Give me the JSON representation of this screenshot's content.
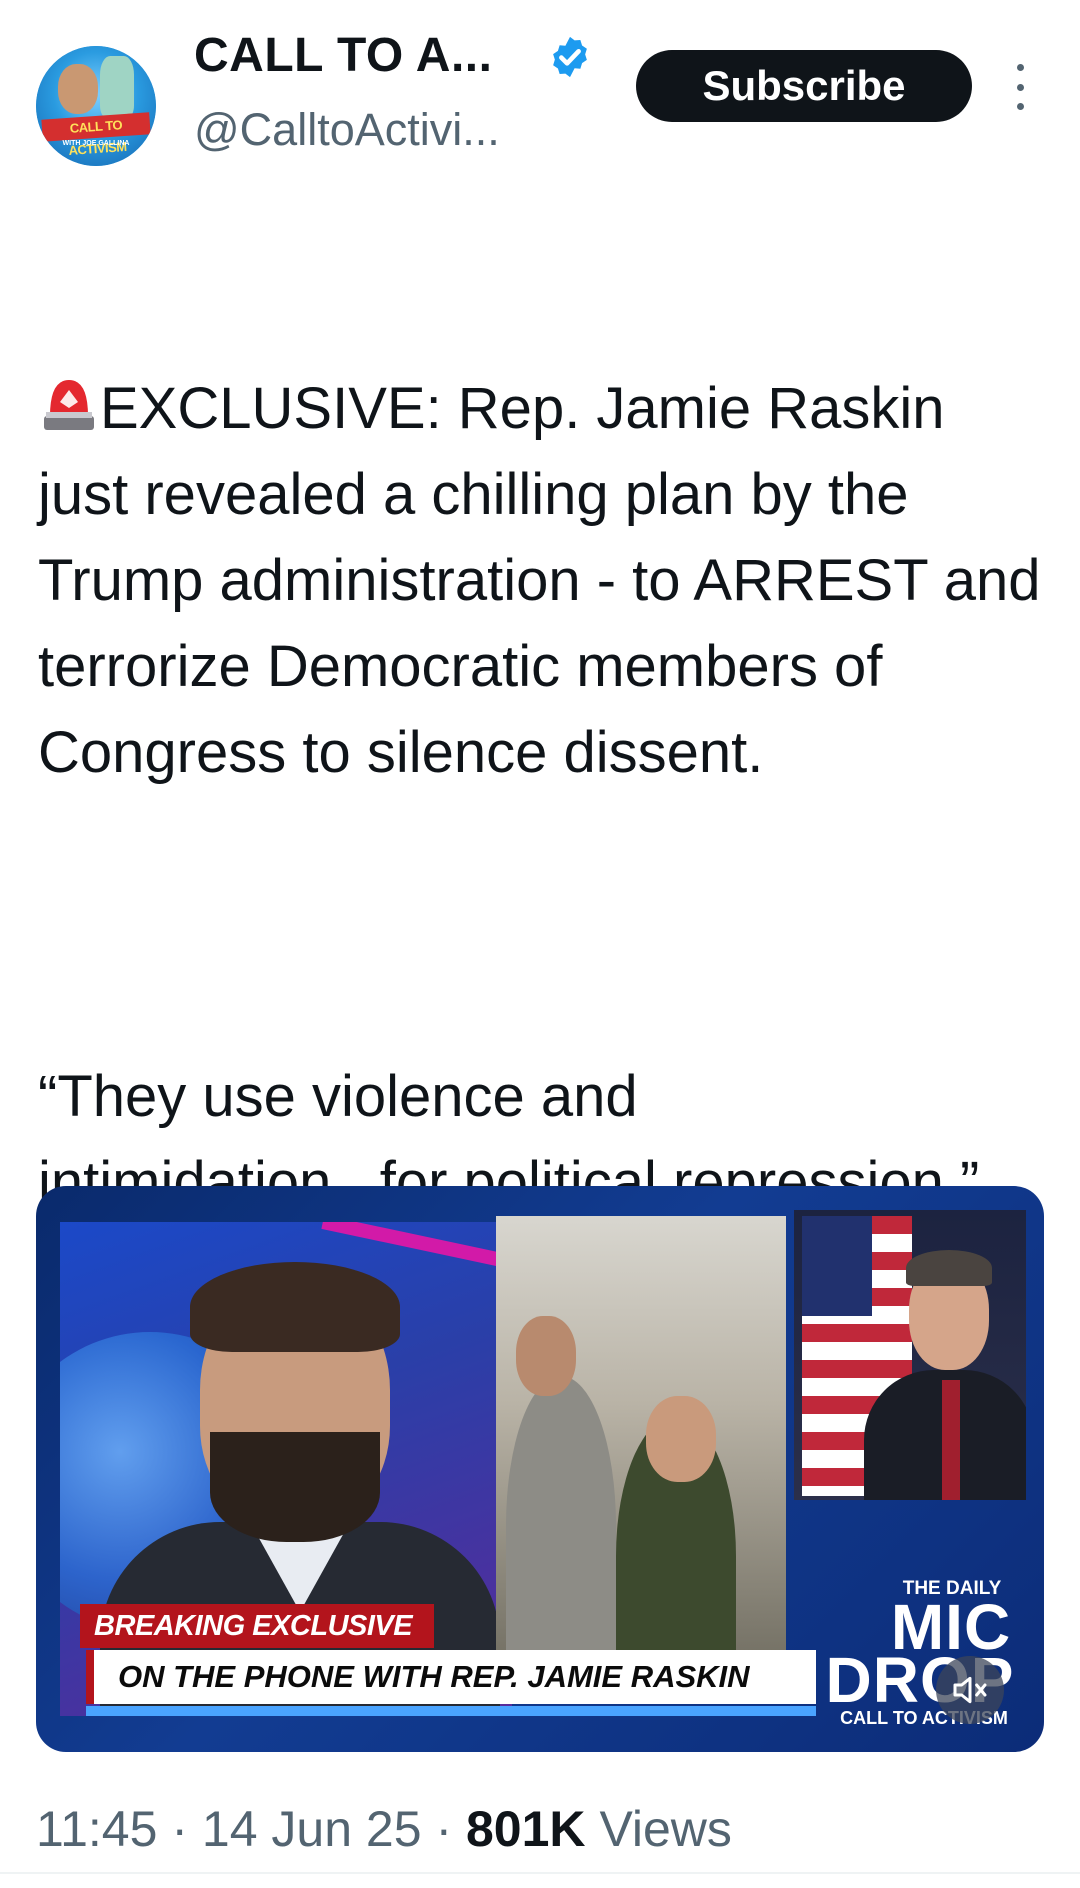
{
  "author": {
    "display_name": "CALL TO A...",
    "handle": "@CalltoActivi...",
    "avatar_text": "CALL TO ACTIVISM",
    "avatar_subtext": "WITH JOE GALLINA",
    "verified_color": "#1d9bf0"
  },
  "actions": {
    "subscribe_label": "Subscribe",
    "more_icon": "more-vertical-icon"
  },
  "tweet": {
    "siren_icon": "siren-icon",
    "paragraph1": "EXCLUSIVE: Rep. Jamie Raskin just revealed a chilling plan by the Trump administration - to ARREST and terrorize Democratic members of Congress to silence dissent.",
    "paragraph2": "“They use violence and intimidation...for political repression.” This is not normal. This is FASCISM. ",
    "thread_icon": "thread-spool-icon"
  },
  "media": {
    "lower_third_top": "BREAKING EXCLUSIVE",
    "lower_third_main": "ON THE PHONE WITH REP. JAMIE RASKIN",
    "logo_line1": "THE DAILY",
    "logo_line2": "MIC",
    "logo_line3": "DROP",
    "logo_line4": "CALL TO ACTIVISM",
    "mute_icon": "muted-speaker-icon"
  },
  "meta": {
    "time": "11:45",
    "separator": "·",
    "date": "14 Jun 25",
    "views_count": "801K",
    "views_label": "Views"
  },
  "colors": {
    "text": "#0f1419",
    "secondary": "#536471",
    "subscribe_bg": "#0f1419",
    "breaking_red": "#b3141c"
  }
}
